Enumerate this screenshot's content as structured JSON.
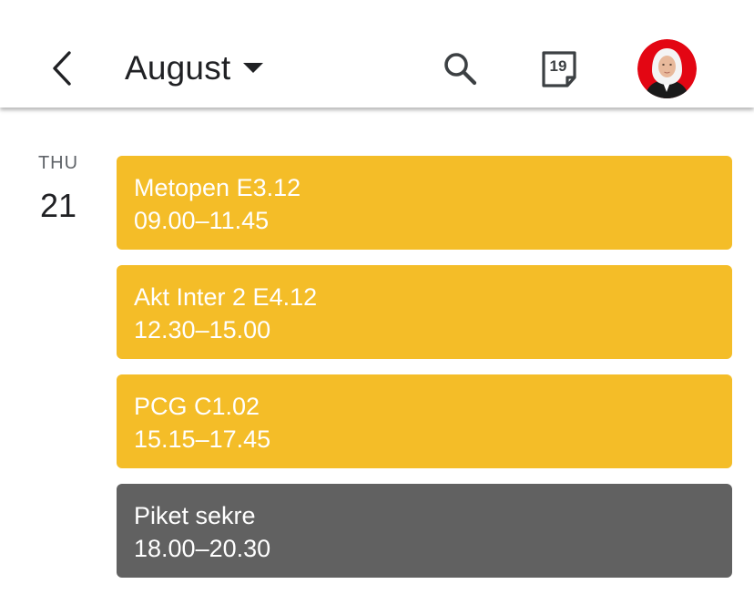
{
  "header": {
    "month": "August",
    "today_date": "19"
  },
  "day": {
    "weekday": "THU",
    "date": "21"
  },
  "events": [
    {
      "title": "Metopen E3.12",
      "time": "09.00–11.45",
      "color": "#f4bd28"
    },
    {
      "title": "Akt Inter 2 E4.12",
      "time": "12.30–15.00",
      "color": "#f4bd28"
    },
    {
      "title": "PCG C1.02",
      "time": "15.15–17.45",
      "color": "#f4bd28"
    },
    {
      "title": "Piket sekre",
      "time": "18.00–20.30",
      "color": "#616161"
    }
  ],
  "colors": {
    "event_yellow": "#f4bd28",
    "event_gray": "#616161",
    "avatar_bg": "#e30613"
  },
  "icons": [
    "back-arrow-icon",
    "caret-down-icon",
    "search-icon",
    "today-calendar-icon",
    "avatar"
  ]
}
